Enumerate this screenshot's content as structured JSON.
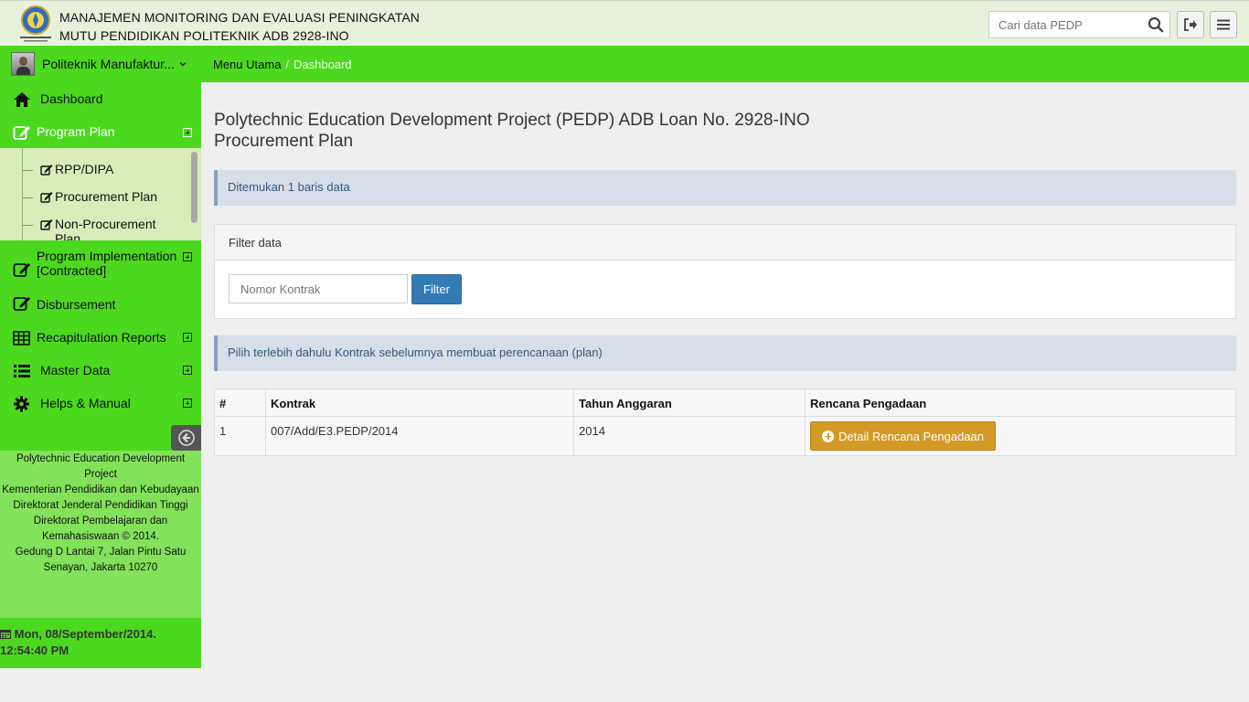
{
  "header": {
    "title_line1": "MANAJEMEN MONITORING DAN EVALUASI PENINGKATAN",
    "title_line2": "MUTU PENDIDIKAN POLITEKNIK ADB 2928-INO",
    "search_placeholder": "Cari data PEDP",
    "icons": [
      "logo-emblem",
      "search-icon",
      "logout-icon",
      "menu-icon"
    ]
  },
  "user": {
    "name": "Politeknik Manufaktur..."
  },
  "breadcrumb": {
    "home": "Menu Utama",
    "separator": "/",
    "current": "Dashboard"
  },
  "sidebar": {
    "items": [
      {
        "label": "Dashboard",
        "icon": "home-icon"
      },
      {
        "label": "Program Plan",
        "icon": "edit-icon"
      },
      {
        "label": "Program Implementation [Contracted]",
        "icon": "edit-icon"
      },
      {
        "label": "Disbursement",
        "icon": "edit-icon"
      },
      {
        "label": "Recapitulation Reports",
        "icon": "table-icon"
      },
      {
        "label": "Master Data",
        "icon": "list-icon"
      },
      {
        "label": "Helps & Manual",
        "icon": "gear-icon"
      }
    ],
    "submenu": [
      {
        "label": "RPP/DIPA"
      },
      {
        "label": "Procurement Plan"
      },
      {
        "label": "Non-Procurement Plan"
      }
    ],
    "footer_lines": [
      "Polytechnic Education Development Project",
      "Kementerian Pendidikan dan Kebudayaan",
      "Direktorat Jenderal Pendidikan Tinggi",
      "Direktorat Pembelajaran dan Kemahasiswaan © 2014.",
      "Gedung D Lantai 7, Jalan Pintu Satu Senayan, Jakarta 10270"
    ],
    "datetime": "Mon, 08/September/2014. 12:54:40 PM"
  },
  "main": {
    "title_line1": "Polytechnic Education Development Project (PEDP) ADB Loan No. 2928-INO",
    "title_line2": "Procurement Plan",
    "found_text": "Ditemukan 1 baris data",
    "filter_heading": "Filter data",
    "filter_placeholder": "Nomor Kontrak",
    "filter_button": "Filter",
    "info_text": "Pilih terlebih dahulu Kontrak sebelumnya membuat perencanaan (plan)",
    "table": {
      "headers": [
        "#",
        "Kontrak",
        "Tahun Anggaran",
        "Rencana Pengadaan"
      ],
      "rows": [
        {
          "no": "1",
          "kontrak": "007/Add/E3.PEDP/2014",
          "tahun": "2014",
          "action": "Detail Rencana Pengadaan"
        }
      ]
    }
  },
  "colors": {
    "green": "#4cd81f",
    "light_green": "#82e25a",
    "submenu_bg": "#d8edba",
    "primary": "#337ab7",
    "warning": "#d49a26"
  }
}
